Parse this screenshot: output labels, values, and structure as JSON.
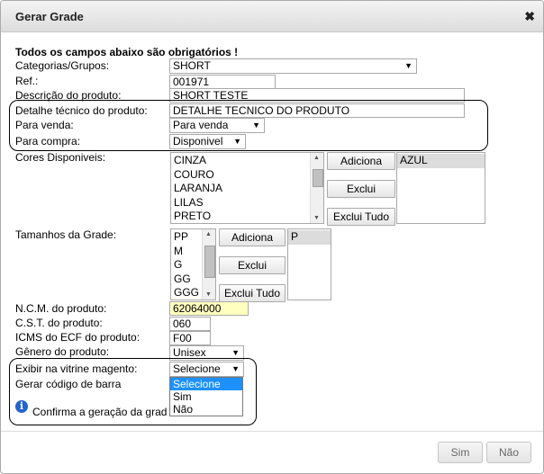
{
  "dialog": {
    "title": "Gerar Grade"
  },
  "form": {
    "required_notice": "Todos os campos abaixo são obrigatórios !",
    "categorias_label": "Categorias/Grupos:",
    "categorias_value": "SHORT",
    "ref_label": "Ref.:",
    "ref_value": "001971",
    "descricao_label": "Descrição do produto:",
    "descricao_value": "SHORT TESTE",
    "detalhe_label": "Detalhe técnico do produto:",
    "detalhe_value": "DETALHE TECNICO DO PRODUTO",
    "para_venda_label": "Para venda:",
    "para_venda_value": "Para venda",
    "para_compra_label": "Para compra:",
    "para_compra_value": "Disponivel",
    "cores_label": "Cores Disponiveis:",
    "cores_options": [
      "CINZA",
      "COURO",
      "LARANJA",
      "LILAS",
      "PRETO"
    ],
    "cores_selected": [
      "AZUL"
    ],
    "tamanhos_label": "Tamanhos da Grade:",
    "tamanhos_options": [
      "PP",
      "M",
      "G",
      "GG",
      "GGG"
    ],
    "tamanhos_selected": [
      "P"
    ],
    "adiciona_label": "Adiciona",
    "exclui_label": "Exclui",
    "exclui_tudo_label": "Exclui Tudo",
    "ncm_label": "N.C.M. do produto:",
    "ncm_value": "62064000",
    "cst_label": "C.S.T. do produto:",
    "cst_value": "060",
    "icms_label": "ICMS do ECF do produto:",
    "icms_value": "F00",
    "genero_label": "Gênero do produto:",
    "genero_value": "Unisex",
    "vitrine_label": "Exibir na vitrine magento:",
    "vitrine_value": "Selecione",
    "vitrine_options": [
      "Selecione",
      "Sim",
      "Não"
    ],
    "barra_label": "Gerar código de barra",
    "confirma_text": "Confirma a geração da grad"
  },
  "footer": {
    "sim_label": "Sim",
    "nao_label": "Não"
  },
  "colors": {
    "ncm_highlight": "#ffffc0",
    "dropdown_highlight": "#1e90ff"
  },
  "icons": {
    "close": "close-icon",
    "info": "info-icon"
  }
}
